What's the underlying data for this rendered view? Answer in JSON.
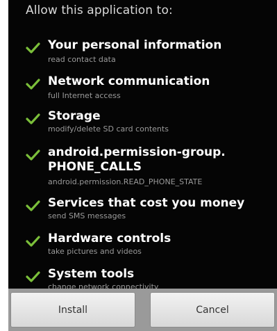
{
  "header": "Allow this application to:",
  "permissions": [
    {
      "title": "Your personal information",
      "desc": "read contact data"
    },
    {
      "title": "Network communication",
      "desc": "full Internet access"
    },
    {
      "title": "Storage",
      "desc": "modify/delete SD card contents"
    },
    {
      "title_line1": "android.permission-group.",
      "title_line2": "PHONE_CALLS",
      "desc": "android.permission.READ_PHONE_STATE"
    },
    {
      "title": "Services that cost you money",
      "desc": "send SMS messages"
    },
    {
      "title": "Hardware controls",
      "desc": "take pictures and videos"
    },
    {
      "title": "System tools",
      "desc": "change network connectivity"
    }
  ],
  "buttons": {
    "install": "Install",
    "cancel": "Cancel"
  },
  "colors": {
    "check": "#7bbf3a",
    "background": "#050505",
    "button_bar": "#9a9a9a"
  },
  "icons": {
    "check": "check-icon"
  }
}
